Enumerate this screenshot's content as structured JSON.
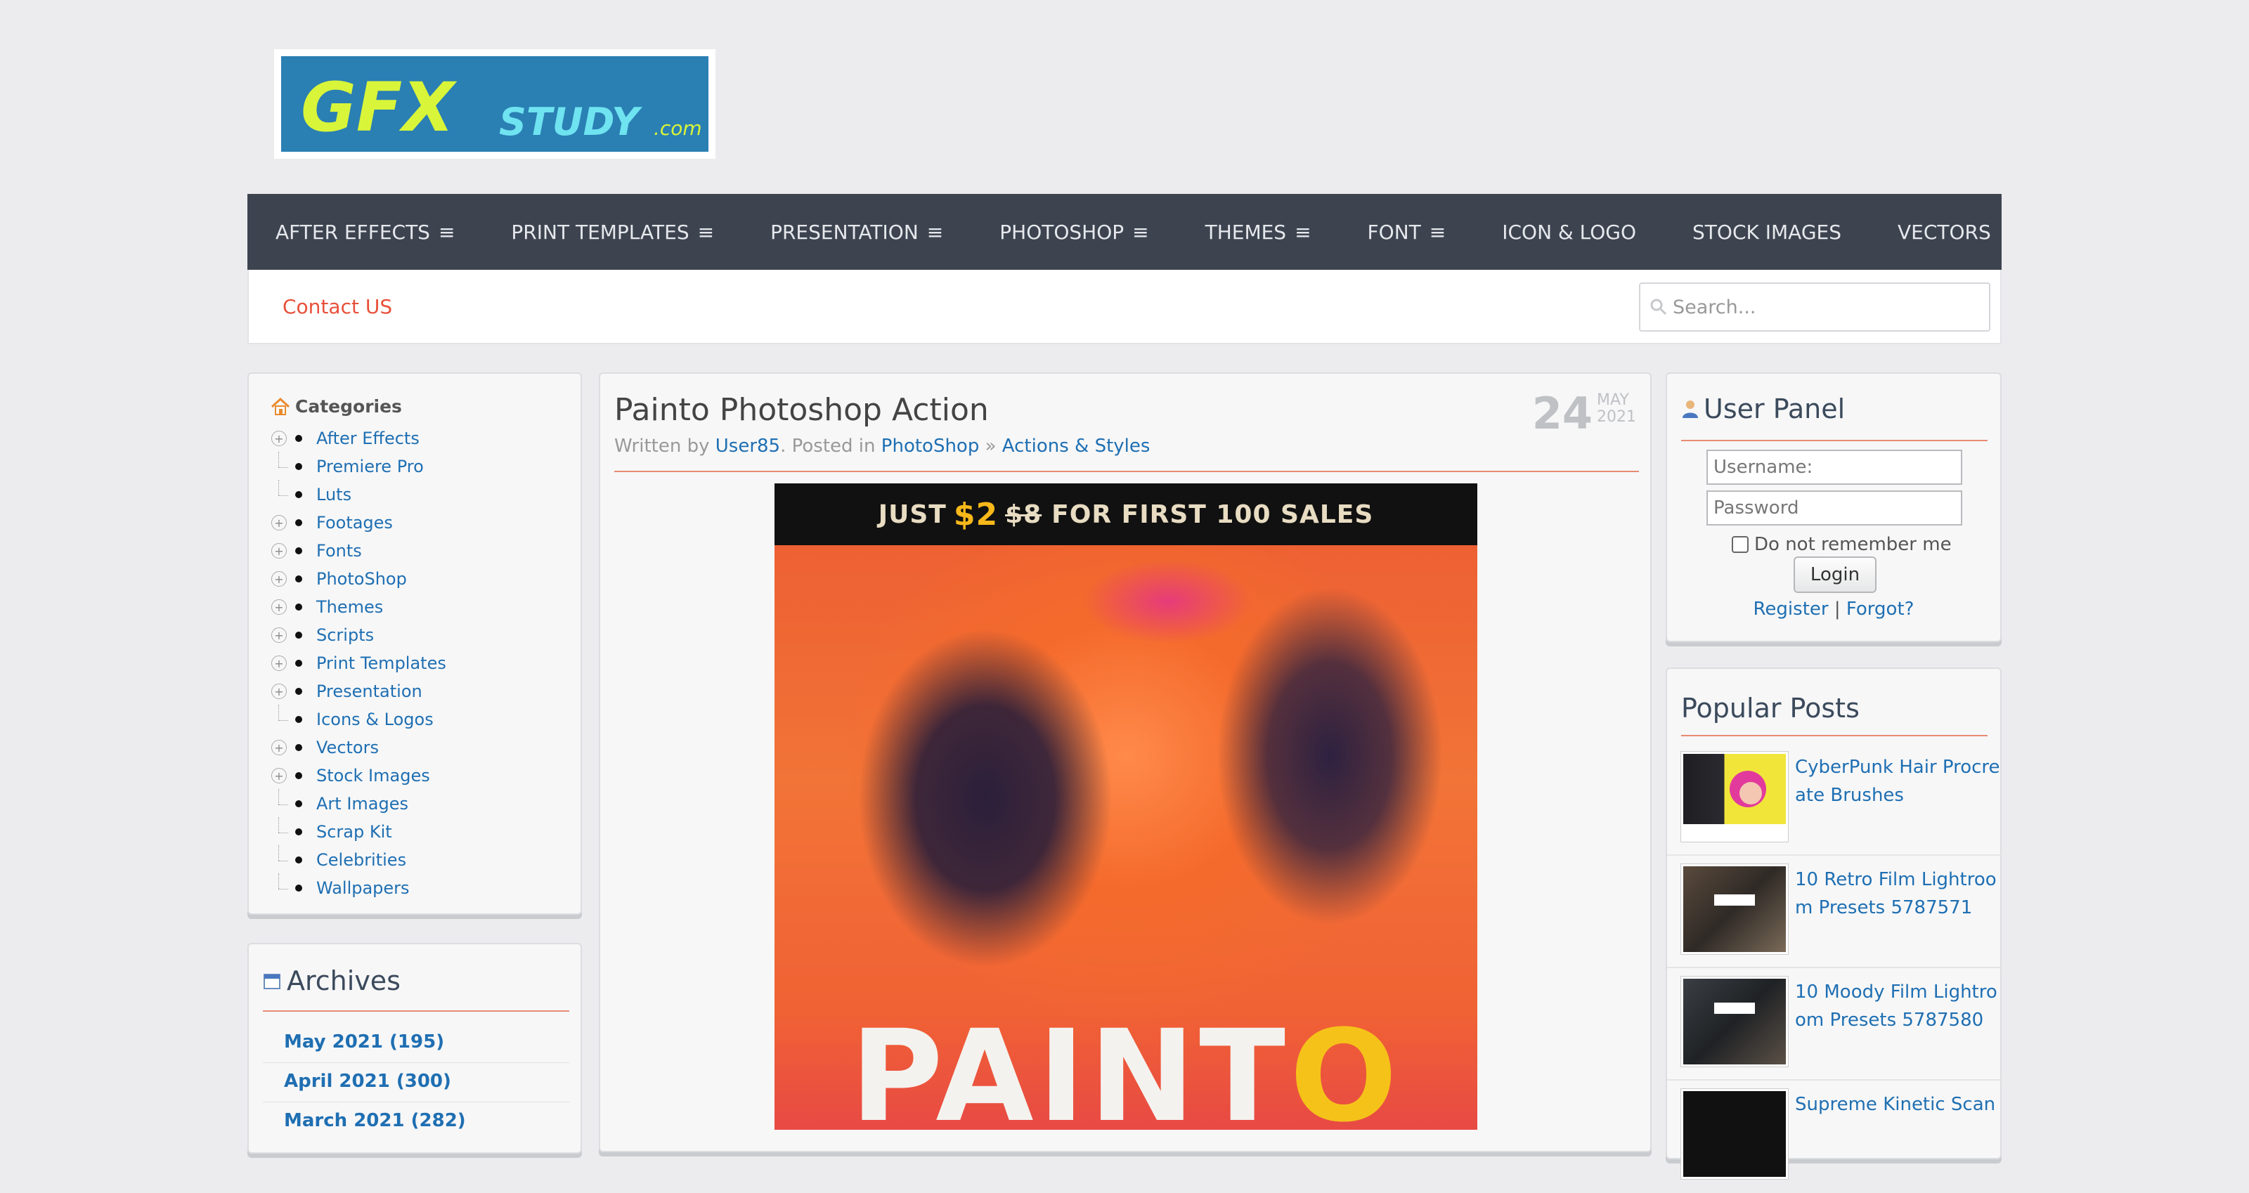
{
  "logo": {
    "text_main": "GFX",
    "text_sub": "STUDY",
    "text_dom": ".com"
  },
  "nav": {
    "items": [
      {
        "label": "AFTER EFFECTS",
        "menu": true
      },
      {
        "label": "PRINT TEMPLATES",
        "menu": true
      },
      {
        "label": "PRESENTATION",
        "menu": true
      },
      {
        "label": "PHOTOSHOP",
        "menu": true
      },
      {
        "label": "THEMES",
        "menu": true
      },
      {
        "label": "FONT",
        "menu": true
      },
      {
        "label": "ICON & LOGO",
        "menu": false
      },
      {
        "label": "STOCK IMAGES",
        "menu": false
      },
      {
        "label": "VECTORS",
        "menu": false
      }
    ],
    "menu_glyph": "≡"
  },
  "subbar": {
    "contact": "Contact US",
    "search_placeholder": "Search..."
  },
  "categories": {
    "title": "Categories",
    "items": [
      {
        "label": "After Effects",
        "expandable": true
      },
      {
        "label": "Premiere Pro",
        "expandable": false
      },
      {
        "label": "Luts",
        "expandable": false
      },
      {
        "label": "Footages",
        "expandable": true
      },
      {
        "label": "Fonts",
        "expandable": true
      },
      {
        "label": "PhotoShop",
        "expandable": true
      },
      {
        "label": "Themes",
        "expandable": true
      },
      {
        "label": "Scripts",
        "expandable": true
      },
      {
        "label": "Print Templates",
        "expandable": true
      },
      {
        "label": "Presentation",
        "expandable": true
      },
      {
        "label": "Icons & Logos",
        "expandable": false
      },
      {
        "label": "Vectors",
        "expandable": true
      },
      {
        "label": "Stock Images",
        "expandable": true
      },
      {
        "label": "Art Images",
        "expandable": false
      },
      {
        "label": "Scrap Kit",
        "expandable": false
      },
      {
        "label": "Celebrities",
        "expandable": false
      },
      {
        "label": "Wallpapers",
        "expandable": false
      }
    ]
  },
  "archives": {
    "title": "Archives",
    "items": [
      "May 2021 (195)",
      "April 2021 (300)",
      "March 2021 (282)"
    ]
  },
  "post": {
    "title": "Painto Photoshop Action",
    "written_by": "Written by",
    "author": "User85",
    "posted_in": ". Posted in",
    "category": "PhotoShop",
    "sep": "»",
    "subcategory": "Actions & Styles",
    "date_day": "24",
    "date_month": "MAY",
    "date_year": "2021",
    "banner_pre": "JUST",
    "banner_price": "$2",
    "banner_old": "$8",
    "banner_post": "FOR FIRST 100 SALES",
    "hero_word_a": "PAINT",
    "hero_word_b": "O"
  },
  "user_panel": {
    "title": "User Panel",
    "username_placeholder": "Username:",
    "password_placeholder": "Password",
    "remember": "Do not remember me",
    "login": "Login",
    "register": "Register",
    "divider": "|",
    "forgot": "Forgot?"
  },
  "popular": {
    "title": "Popular Posts",
    "items": [
      "CyberPunk Hair Procreate Brushes",
      "10 Retro Film Lightroom Presets 5787571",
      "10 Moody Film Lightroom Presets 5787580",
      "Supreme Kinetic Scan P"
    ]
  },
  "colors": {
    "nav_bg": "#3d4450",
    "link": "#1f6fb2",
    "accent_line": "#e88b72",
    "contact": "#e8503a"
  }
}
